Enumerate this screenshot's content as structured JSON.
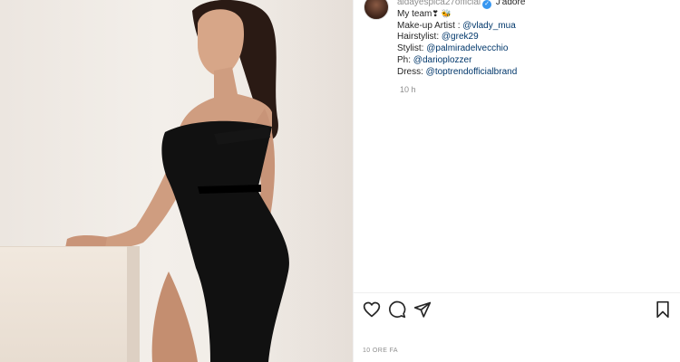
{
  "post": {
    "username": "aidayespica27official",
    "verified_mark": "✓",
    "caption_lines": [
      {
        "text": "J'adore",
        "mention": ""
      },
      {
        "text": "My team",
        "emojis": "❣ 🐝"
      },
      {
        "label": "Make-up Artist : ",
        "mention": "@vlady_mua"
      },
      {
        "label": "Hairstylist: ",
        "mention": "@grek29"
      },
      {
        "label": "Stylist: ",
        "mention": "@palmiradelvecchio"
      },
      {
        "label": "Ph: ",
        "mention": "@darioplozzer"
      },
      {
        "label": "Dress: ",
        "mention": "@toptrendofficialbrand"
      }
    ],
    "relative_time": "10 h",
    "date_label": "10 ORE FA"
  },
  "icons": {
    "like": "heart-icon",
    "comment": "comment-icon",
    "share": "share-icon",
    "save": "bookmark-icon"
  },
  "colors": {
    "mention": "#00376b",
    "verified": "#3897f0",
    "muted": "#8e8e8e"
  }
}
